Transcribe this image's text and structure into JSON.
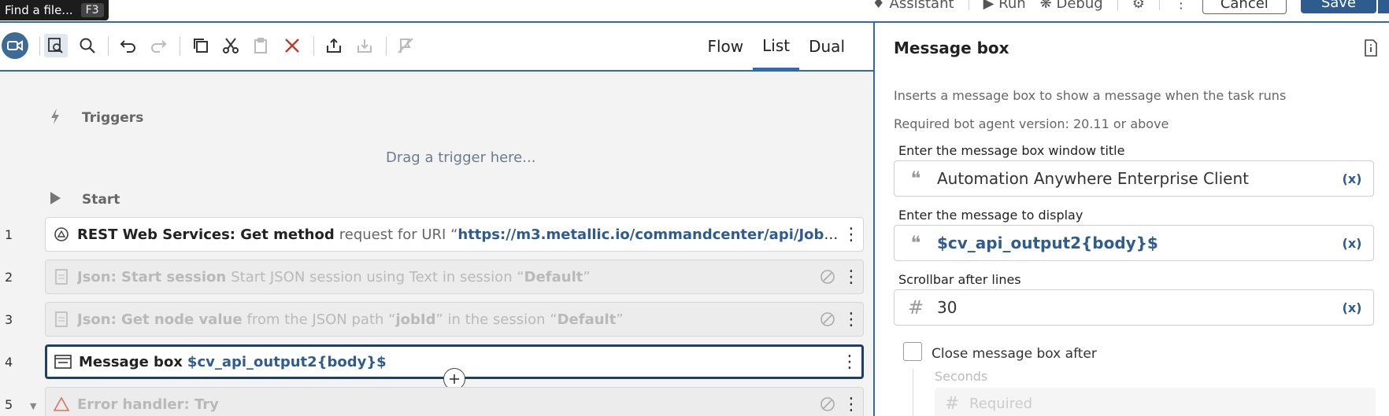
{
  "tooltip": {
    "text": "Find a file...",
    "shortcut": "F3"
  },
  "header": {
    "assistant": "Assistant",
    "run": "Run",
    "debug": "Debug",
    "cancel": "Cancel",
    "save": "Save"
  },
  "views": [
    "Flow",
    "List",
    "Dual"
  ],
  "active_view": "List",
  "editor": {
    "triggers_label": "Triggers",
    "drag_hint": "Drag a trigger here...",
    "start_label": "Start",
    "lines": [
      {
        "num": "1",
        "title": "REST Web Services: Get method",
        "desc": "request for URI “",
        "value": "https://m3.metallic.io/commandcenter/api/Job?com...",
        "disabled": false
      },
      {
        "num": "2",
        "title": "Json: Start session",
        "desc": "Start JSON session using Text in session “",
        "value": "Default",
        "tail": "”",
        "disabled": true
      },
      {
        "num": "3",
        "title": "Json: Get node value",
        "desc": "from the JSON path “",
        "value": "jobId",
        "mid": "” in the session “",
        "value2": "Default",
        "tail": "”",
        "disabled": true
      },
      {
        "num": "4",
        "title": "Message box",
        "value": "$cv_api_output2{body}$",
        "disabled": false
      },
      {
        "num": "5",
        "title": "Error handler: Try",
        "disabled": true
      }
    ]
  },
  "panel": {
    "title": "Message box",
    "description": "Inserts a message box to show a message when the task runs",
    "version": "Required bot agent version: 20.11 or above",
    "fields": [
      {
        "label": "Enter the message box window title",
        "value": "Automation Anywhere Enterprise Client",
        "icon": "quote-icon"
      },
      {
        "label": "Enter the message to display",
        "value": "$cv_api_output2{body}$",
        "icon": "quote-icon"
      },
      {
        "label": "Scrollbar after lines",
        "value": "30",
        "icon": "hash-icon"
      }
    ],
    "var_button": "(x)",
    "close_after_label": "Close message box after",
    "seconds_label": "Seconds",
    "seconds_placeholder": "Required"
  },
  "colors": {
    "accent": "#2e6ab1",
    "brand_dark": "#2f5c8e",
    "delete_red": "#c0392b"
  }
}
